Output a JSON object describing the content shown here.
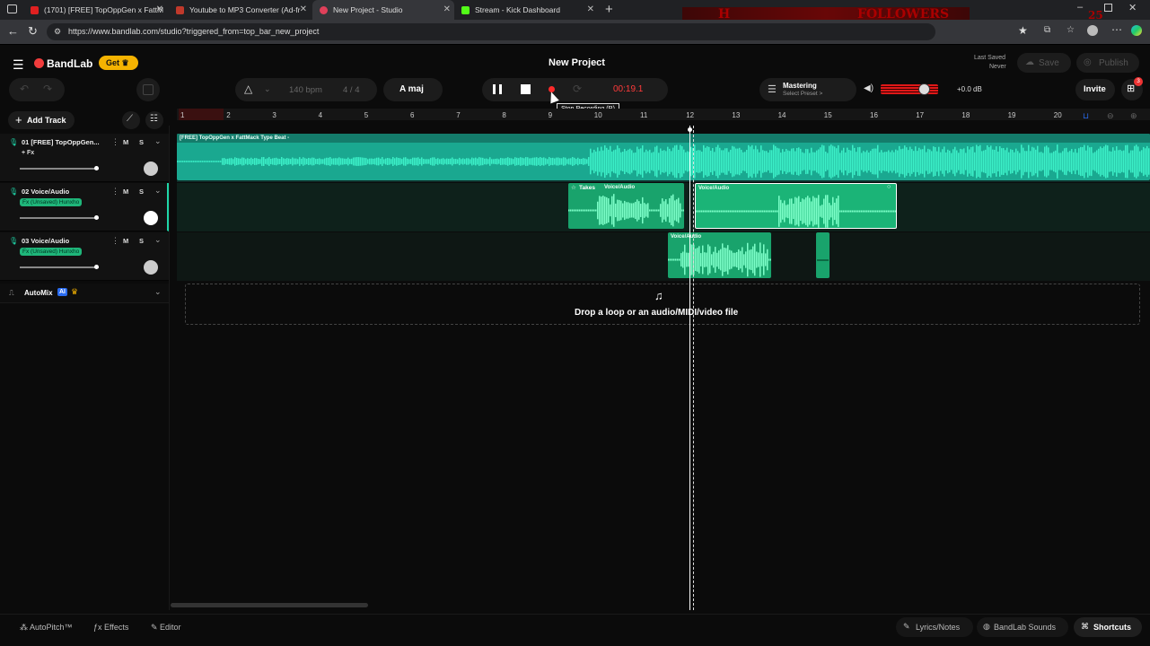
{
  "browser": {
    "tabs": [
      {
        "title": "(1701) [FREE] TopOppGen x FattM",
        "color": "#e02020"
      },
      {
        "title": "Youtube to MP3 Converter (Ad-fr",
        "color": "#c0392b"
      },
      {
        "title": "New Project - Studio",
        "color": "#e0405a"
      },
      {
        "title": "Stream - Kick Dashboard",
        "color": "#53fc18"
      }
    ],
    "url": "https://www.bandlab.com/studio?triggered_from=top_bar_new_project",
    "overlay_followers": "FOLLOWERS",
    "overlay_count": "25",
    "overlay_letter": "H"
  },
  "header": {
    "brand": "BandLab",
    "get_label": "Get",
    "project_title": "New Project",
    "last_saved_label": "Last Saved",
    "last_saved_value": "Never",
    "save_label": "Save",
    "publish_label": "Publish"
  },
  "transport": {
    "bpm": "140 bpm",
    "time_signature": "4 / 4",
    "key": "A maj",
    "time": "00:19.1",
    "tooltip": "Stop Recording (R)",
    "mastering_label": "Mastering",
    "mastering_preset": "Select Preset >",
    "volume_db": "+0.0 dB",
    "invite_label": "Invite",
    "notification_count": "3",
    "volume_level": 0.8
  },
  "tracks_panel": {
    "add_track_label": "Add Track",
    "tracks": [
      {
        "name": "01  [FREE] TopOppGen...",
        "fx": "+ Fx",
        "m": "M",
        "s": "S"
      },
      {
        "name": "02  Voice/Audio",
        "fx": "Fx (Unsaved) Hunxho",
        "m": "M",
        "s": "S"
      },
      {
        "name": "03  Voice/Audio",
        "fx": "Fx (Unsaved) Hunxho",
        "m": "M",
        "s": "S"
      }
    ],
    "automix_label": "AutoMix",
    "ai_badge": "AI"
  },
  "timeline": {
    "bars": [
      "1",
      "2",
      "3",
      "4",
      "5",
      "6",
      "7",
      "8",
      "9",
      "10",
      "11",
      "12",
      "13",
      "14",
      "15",
      "16",
      "17",
      "18",
      "19",
      "20"
    ],
    "clip_beat": "[FREE] TopOppGen x FattMack Type Beat -",
    "clip_takes": "Takes",
    "clip_voice": "Voice/Audio",
    "drop_text": "Drop a loop or an audio/MIDI/video file"
  },
  "footer": {
    "autopitch": "AutoPitch™",
    "effects": "Effects",
    "editor": "Editor",
    "lyrics": "Lyrics/Notes",
    "sounds": "BandLab Sounds",
    "shortcuts": "Shortcuts"
  },
  "colors": {
    "accent": "#1fd6a8",
    "record": "#ff2a2a",
    "get_badge": "#f5b301"
  }
}
